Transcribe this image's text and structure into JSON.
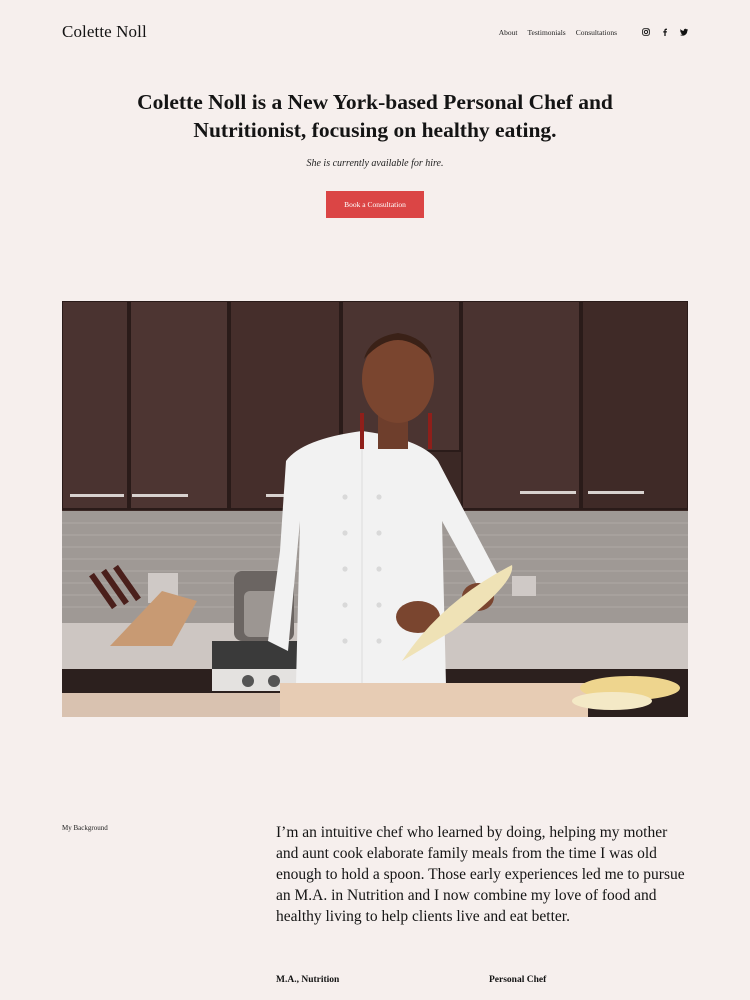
{
  "header": {
    "logo": "Colette Noll",
    "nav": [
      "About",
      "Testimonials",
      "Consultations"
    ],
    "social": [
      "instagram-icon",
      "facebook-icon",
      "twitter-icon"
    ]
  },
  "hero": {
    "title": "Colette Noll is a New York-based Personal Chef and Nutritionist, focusing on healthy eating.",
    "subtitle": "She is currently available for hire.",
    "cta_label": "Book a Consultation"
  },
  "colors": {
    "background": "#f6efed",
    "accent": "#db4545"
  },
  "background_section": {
    "label": "My Background",
    "bio": "I’m an intuitive chef who learned by doing, helping my mother and aunt cook elaborate family meals from the time I was old enough to hold a spoon. Those early experiences led me to pursue an M.A. in Nutrition and I now combine my love of food and healthy living to help clients live and eat better.",
    "credentials": [
      "M.A., Nutrition",
      "Personal Chef"
    ]
  }
}
